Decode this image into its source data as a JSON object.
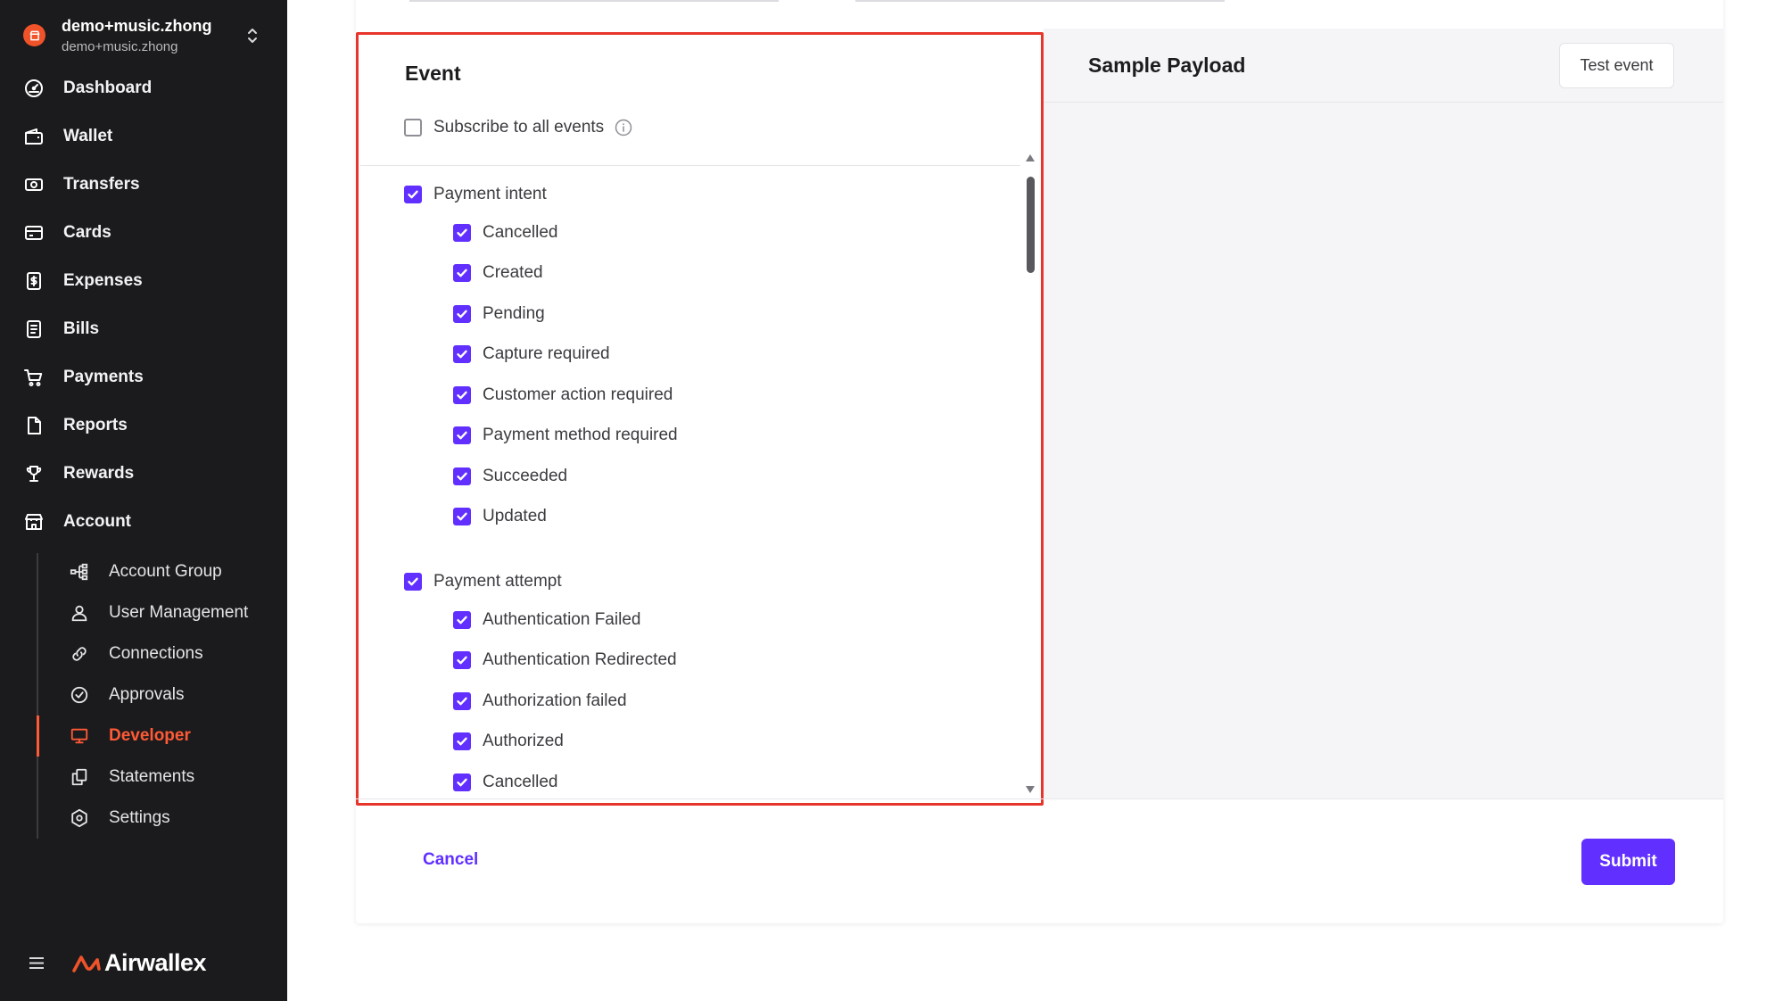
{
  "account": {
    "name": "demo+music.zhong",
    "subtitle": "demo+music.zhong",
    "avatar_icon": "store-icon"
  },
  "nav": [
    {
      "label": "Dashboard",
      "icon": "dashboard-icon"
    },
    {
      "label": "Wallet",
      "icon": "wallet-icon"
    },
    {
      "label": "Transfers",
      "icon": "transfers-icon"
    },
    {
      "label": "Cards",
      "icon": "card-icon"
    },
    {
      "label": "Expenses",
      "icon": "expenses-icon"
    },
    {
      "label": "Bills",
      "icon": "bills-icon"
    },
    {
      "label": "Payments",
      "icon": "cart-icon"
    },
    {
      "label": "Reports",
      "icon": "report-icon"
    },
    {
      "label": "Rewards",
      "icon": "trophy-icon"
    },
    {
      "label": "Account",
      "icon": "building-icon"
    }
  ],
  "account_submenu": [
    {
      "label": "Account Group",
      "icon": "hierarchy-icon",
      "active": false
    },
    {
      "label": "User Management",
      "icon": "user-icon",
      "active": false
    },
    {
      "label": "Connections",
      "icon": "link-icon",
      "active": false
    },
    {
      "label": "Approvals",
      "icon": "check-circle-icon",
      "active": false
    },
    {
      "label": "Developer",
      "icon": "monitor-icon",
      "active": true
    },
    {
      "label": "Statements",
      "icon": "copy-icon",
      "active": false
    },
    {
      "label": "Settings",
      "icon": "settings-icon",
      "active": false
    }
  ],
  "brand": {
    "name": "Airwallex"
  },
  "event_panel": {
    "title": "Event",
    "subscribe_all": {
      "label": "Subscribe to all events",
      "checked": false
    },
    "groups": [
      {
        "label": "Payment intent",
        "checked": true,
        "events": [
          {
            "label": "Cancelled",
            "checked": true
          },
          {
            "label": "Created",
            "checked": true
          },
          {
            "label": "Pending",
            "checked": true
          },
          {
            "label": "Capture required",
            "checked": true
          },
          {
            "label": "Customer action required",
            "checked": true
          },
          {
            "label": "Payment method required",
            "checked": true
          },
          {
            "label": "Succeeded",
            "checked": true
          },
          {
            "label": "Updated",
            "checked": true
          }
        ]
      },
      {
        "label": "Payment attempt",
        "checked": true,
        "events": [
          {
            "label": "Authentication Failed",
            "checked": true
          },
          {
            "label": "Authentication Redirected",
            "checked": true
          },
          {
            "label": "Authorization failed",
            "checked": true
          },
          {
            "label": "Authorized",
            "checked": true
          },
          {
            "label": "Cancelled",
            "checked": true
          }
        ]
      }
    ]
  },
  "payload_panel": {
    "title": "Sample Payload",
    "test_button": "Test event"
  },
  "footer": {
    "cancel": "Cancel",
    "submit": "Submit"
  },
  "colors": {
    "accent": "#612fff",
    "active_nav": "#ff5a36",
    "sidebar_bg": "#1b1b1d",
    "payload_bg": "#f5f5f7",
    "highlight_border": "#e8352b",
    "brand": "#f0532a"
  }
}
